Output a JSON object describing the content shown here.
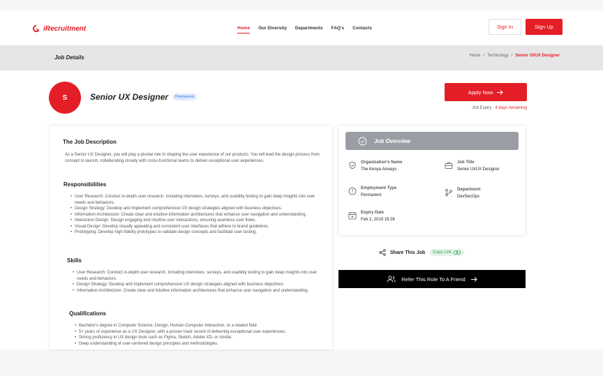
{
  "header": {
    "logo_text": "iRecruitment",
    "nav": [
      "Home",
      "Our Diversity",
      "Departments",
      "FAQ's",
      "Contacts"
    ],
    "signin_label": "Sign In",
    "signup_label": "Sign Up"
  },
  "subbar": {
    "title": "Job Details",
    "breadcrumb": [
      "Home",
      "/",
      "Technology",
      "/",
      "Senior UI/UX Designer"
    ]
  },
  "job": {
    "avatar_letter": "S",
    "title": "Senior UX Designer",
    "badge": "Permanent",
    "apply_label": "Apply Now",
    "expiry_label": "Job Expiry :",
    "expiry_remaining": "4 days remaining"
  },
  "description": {
    "heading": "The Job Description",
    "text": "As a Senior UX Designer, you will play a pivotal role in shaping the user experience of our products. You will lead the design process from concept to launch, collaborating closely with cross-functional teams to deliver exceptional user experiences.",
    "responsibilities_heading": "Responsibilities",
    "responsibilities": [
      "User Research: Conduct in-depth user research, including interviews, surveys, and usability testing to gain deep insights into user needs and behaviors.",
      "Design Strategy: Develop and implement comprehensive UX design strategies aligned with business objectives.",
      "Information Architecture: Create clear and intuitive information architectures that enhance user navigation and understanding.",
      "Interaction Design: Design engaging and intuitive user interactions, ensuring seamless user flows.",
      "Visual Design: Develop visually appealing and consistent user interfaces that adhere to brand guidelines.",
      "Prototyping: Develop high-fidelity prototypes to validate design concepts and facilitate user testing."
    ],
    "skills_heading": "Skills",
    "skills": [
      "User Research: Conduct in-depth user research, including interviews, surveys, and usability testing to gain deep insights into user needs and behaviors.",
      "Design Strategy: Develop and implement comprehensive UX design strategies aligned with business objectives.",
      "Information Architecture: Create clear and intuitive information architectures that enhance user navigation and understanding."
    ],
    "qualifications_heading": "Qualifications",
    "qualifications": [
      "Bachelor's degree in Computer Science, Design, Human-Computer Interaction, or a related field.",
      "5+ years of experience as a UX Designer, with a proven track record of delivering exceptional user experiences.",
      "Strong proficiency in UX design tools such as Figma, Sketch, Adobe XD, or similar.",
      "Deep understanding of user-centered design principles and methodologies."
    ]
  },
  "overview": {
    "heading": "Job Overview",
    "org_label": "Organization's Name",
    "org_value": "The Kenya Airways",
    "jobtitle_label": "Job Title",
    "jobtitle_value": "Senior UI/UX Designer",
    "employment_label": "Employment Type",
    "employment_value": "Permanent",
    "department_label": "Department",
    "department_value": "DevSecOps",
    "expiry_label": "Expiry Date",
    "expiry_value": "Feb 2, 2019 19:28"
  },
  "share": {
    "label": "Share This Job",
    "copy_label": "Copy Link"
  },
  "refer": {
    "label": "Refer This Role To A Friend"
  },
  "colors": {
    "brand_red": "#e41e26",
    "overview_gray": "#9a9ea4"
  }
}
